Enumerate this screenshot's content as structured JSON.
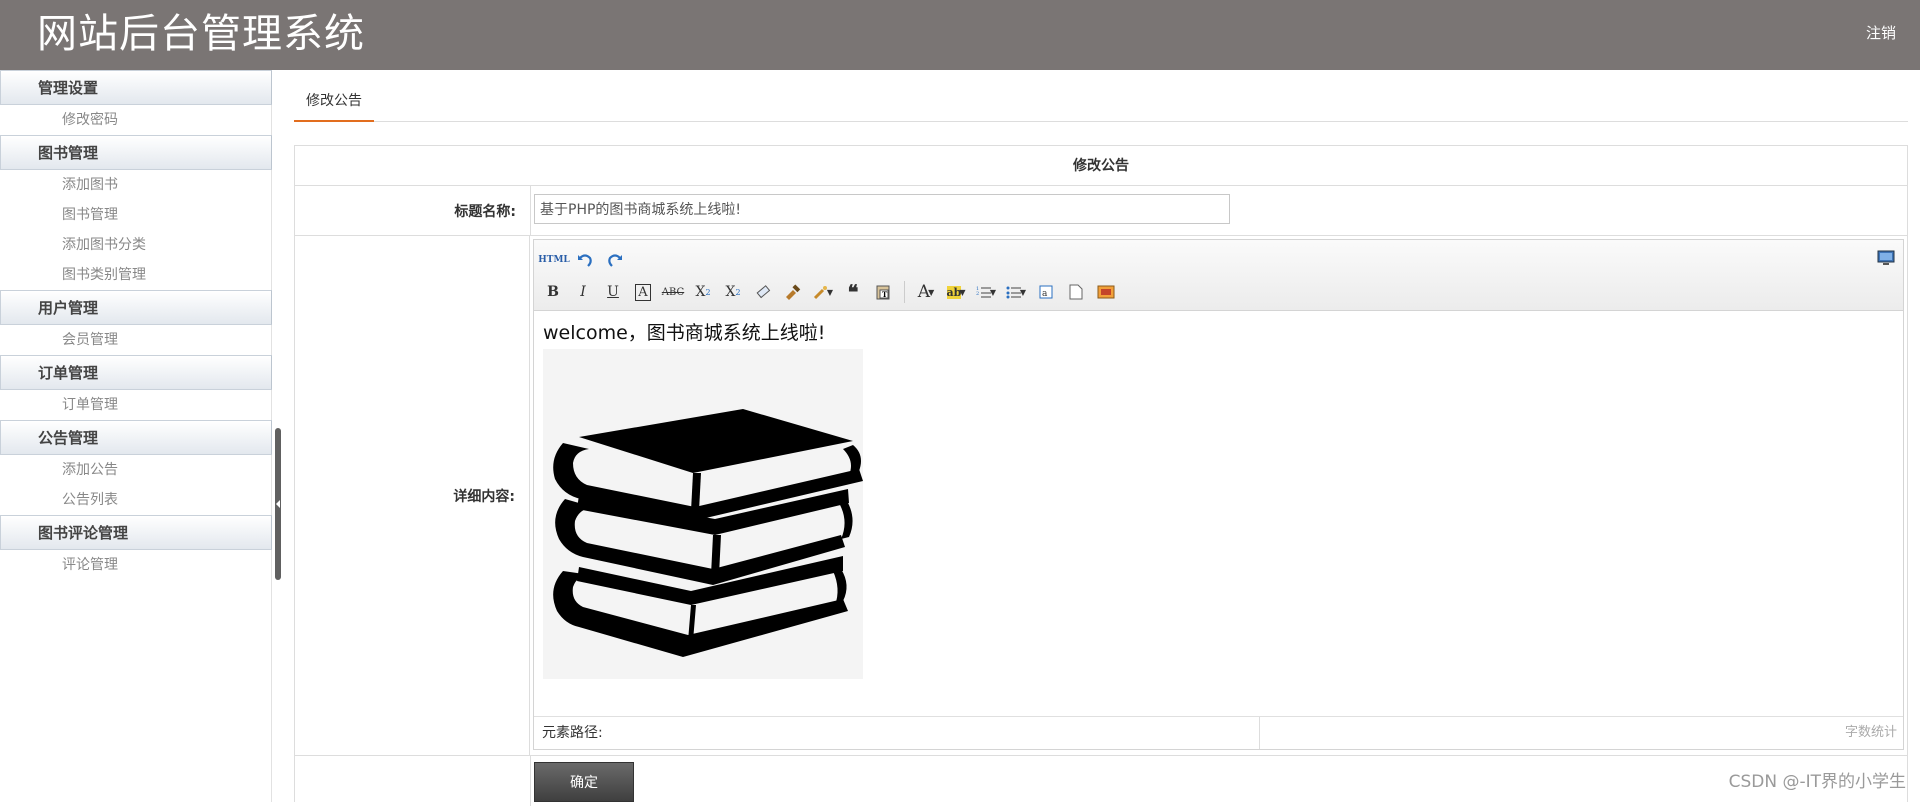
{
  "header": {
    "title": "网站后台管理系统",
    "logout": "注销",
    "bg_color": "#7a7574"
  },
  "sidebar": {
    "groups": [
      {
        "title": "管理设置",
        "items": [
          "修改密码"
        ]
      },
      {
        "title": "图书管理",
        "items": [
          "添加图书",
          "图书管理",
          "添加图书分类",
          "图书类别管理"
        ]
      },
      {
        "title": "用户管理",
        "items": [
          "会员管理"
        ]
      },
      {
        "title": "订单管理",
        "items": [
          "订单管理"
        ]
      },
      {
        "title": "公告管理",
        "items": [
          "添加公告",
          "公告列表"
        ]
      },
      {
        "title": "图书评论管理",
        "items": [
          "评论管理"
        ]
      }
    ]
  },
  "main": {
    "tab": "修改公告",
    "form_heading": "修改公告",
    "title_label": "标题名称:",
    "title_value": "基于PHP的图书商城系统上线啦!",
    "content_label": "详细内容:",
    "editor": {
      "content_text": "welcome，图书商城系统上线啦!",
      "element_path": "元素路径:",
      "word_count": "字数统计",
      "toolbar_icons": [
        "html-source-icon",
        "undo-icon",
        "redo-icon",
        "bold-icon",
        "italic-icon",
        "underline-icon",
        "font-border-icon",
        "strikethrough-icon",
        "superscript-icon",
        "subscript-icon",
        "eraser-icon",
        "format-brush-icon",
        "auto-format-icon",
        "blockquote-icon",
        "paste-text-icon",
        "font-color-icon",
        "highlight-icon",
        "ordered-list-icon",
        "unordered-list-icon",
        "select-all-icon",
        "clear-doc-icon",
        "insert-image-icon",
        "fullscreen-icon"
      ]
    },
    "submit": "确定"
  },
  "watermark": "CSDN @-IT界的小学生",
  "accent_color": "#e26d1e"
}
